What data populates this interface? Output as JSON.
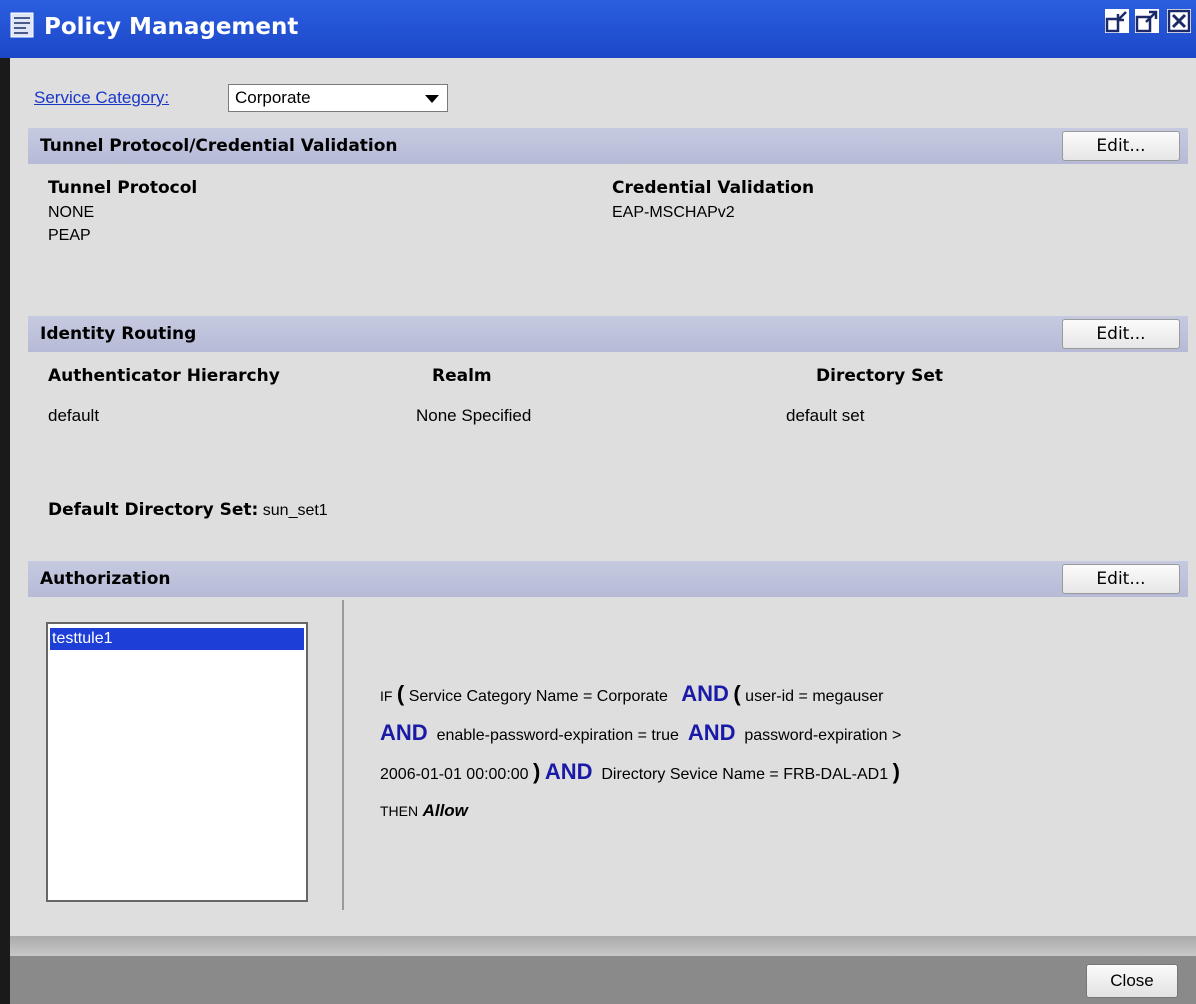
{
  "window": {
    "title": "Policy Management"
  },
  "service_category": {
    "label": "Service Category:",
    "value": "Corporate"
  },
  "tunnel": {
    "title": "Tunnel Protocol/Credential Validation",
    "edit_label": "Edit...",
    "protocol_header": "Tunnel Protocol",
    "protocols": [
      "NONE",
      "PEAP"
    ],
    "credential_header": "Credential Validation",
    "credentials": [
      "EAP-MSCHAPv2"
    ]
  },
  "identity": {
    "title": "Identity Routing",
    "edit_label": "Edit...",
    "columns": [
      "Authenticator Hierarchy",
      "Realm",
      "Directory Set"
    ],
    "row": [
      "default",
      "None Specified",
      "default set"
    ],
    "default_dir_label": "Default Directory Set:",
    "default_dir_value": "sun_set1"
  },
  "authorization": {
    "title": "Authorization",
    "edit_label": "Edit...",
    "rules": [
      "testtule1"
    ],
    "rule_text": {
      "if": "IF",
      "open1": "(",
      "c1": "Service Category Name = Corporate",
      "and1": "AND",
      "open2": "(",
      "c2": "user-id = megauser",
      "and2": "AND",
      "c3": "enable-password-expiration = true",
      "and3": "AND",
      "c4a": "password-expiration >",
      "c4b": "2006-01-01 00:00:00",
      "close1": ")",
      "and4": "AND",
      "c5": "Directory Sevice Name = FRB-DAL-AD1",
      "close2": ")",
      "then": "THEN",
      "allow": "Allow"
    }
  },
  "footer": {
    "close_label": "Close"
  }
}
